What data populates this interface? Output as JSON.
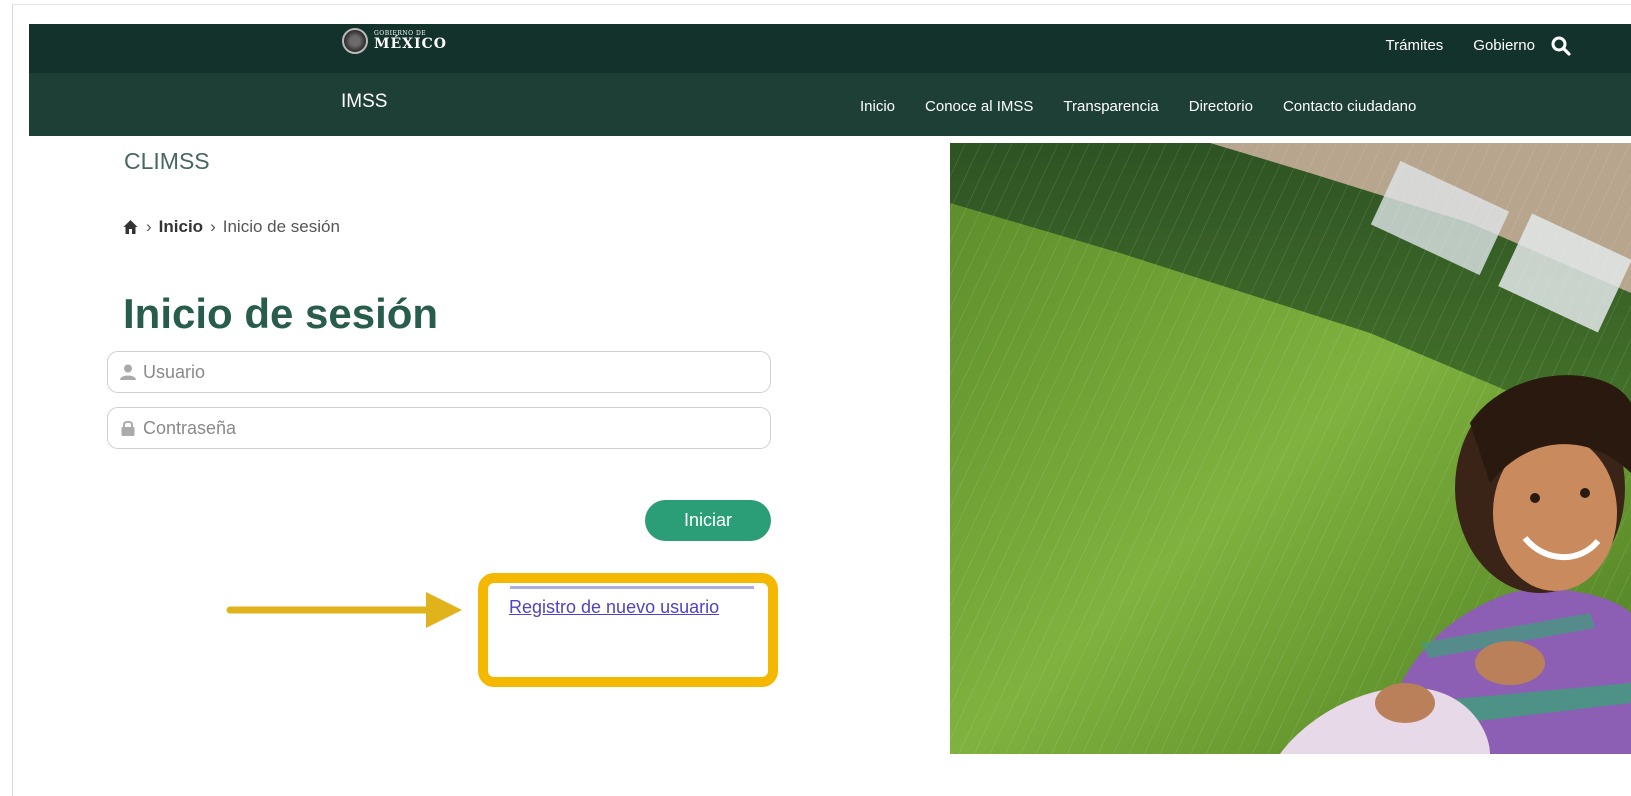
{
  "header": {
    "gov_logo_small": "GOBIERNO DE",
    "gov_logo_big": "MÉXICO",
    "top_links": [
      "Trámites",
      "Gobierno"
    ],
    "search_icon": "search-icon"
  },
  "nav": {
    "brand": "IMSS",
    "items": [
      "Inicio",
      "Conoce al IMSS",
      "Transparencia",
      "Directorio",
      "Contacto ciudadano"
    ]
  },
  "page": {
    "site_name": "CLIMSS",
    "breadcrumb": {
      "home_icon": "home-icon",
      "sep": "›",
      "item1": "Inicio",
      "item2": "Inicio de sesión"
    },
    "title": "Inicio de sesión"
  },
  "form": {
    "user_placeholder": "Usuario",
    "user_icon": "user-icon",
    "pass_placeholder": "Contraseña",
    "pass_icon": "lock-icon",
    "submit_label": "Iniciar",
    "register_link": "Registro de nuevo usuario"
  },
  "colors": {
    "topbar": "#13322b",
    "navbar": "#1e3f36",
    "title": "#285c4d",
    "button": "#2c9e77",
    "highlight": "#f5b800",
    "arrow": "#e0b21c",
    "link": "#4f43c7"
  }
}
